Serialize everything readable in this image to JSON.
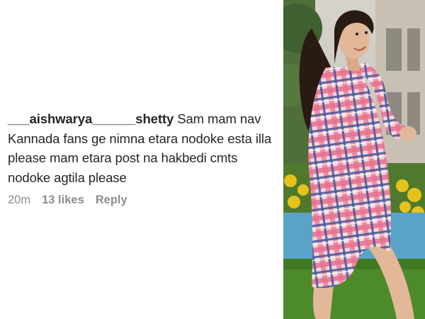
{
  "comment": {
    "username": "___aishwarya______shetty",
    "text": " Sam mam nav Kannada fans ge nimna etara nodoke esta illa please mam etara post na hakbedi cmts nodoke agtila please",
    "time": "20m",
    "likes": "13 likes",
    "reply_label": "Reply"
  },
  "photo": {
    "subject": "woman-in-plaid-shirt",
    "colors": {
      "shirt_pink": "#e8708e",
      "shirt_blue": "#4a5a9a",
      "foliage": "#4f7a2e",
      "flowers": "#e6c21c",
      "building": "#c9c2b4"
    }
  }
}
